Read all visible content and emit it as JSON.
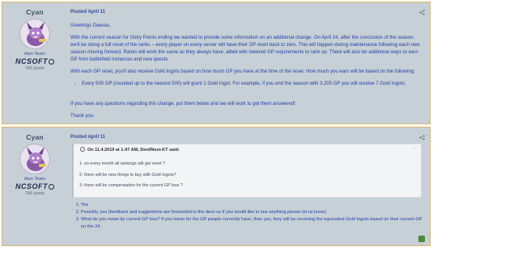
{
  "post1": {
    "author": {
      "name": "Cyan",
      "role": "Aion Team",
      "company": "NCSOFT",
      "post_count": "766 posts"
    },
    "date": "Posted April 11",
    "paragraphs": [
      "Greetings Daevas,",
      "With the current season for Glory Points ending we wanted to provide some information on an additional change. On April 24,  after the conclusion of the season, we'll be doing a full reset of the ranks – every player on every server will have their GP reset back to zero. This will happen during maintenance following each new season moving forward. Ranks will work the same as they always have, albeit with lowered GP requirements to rank up. There will also be additional ways to earn GP from battlefield instances and new quests.",
      "With each GP reset, you'll also receive Gold Ingots based on how much GP you have at the time of the reset.  How much you earn will be based on the following:"
    ],
    "bullets": [
      "Every 500 GP (rounded up to the nearest 500) will grant 1 Gold Ingot. For example, if you end the season with 3,205 GP you will receive 7 Gold Ingots."
    ],
    "closing": [
      "If you have any questions regarding this change, put them below and we will work to get them answered!",
      "Thank you."
    ]
  },
  "post2": {
    "author": {
      "name": "Cyan",
      "role": "Aion Team",
      "company": "NCSOFT",
      "post_count": "766 posts"
    },
    "date": "Posted April 11",
    "quote": {
      "header": "On 11.4.2019 at 1:47 AM, DevilNest-KT said:",
      "lines": [
        "1- so every month all rankings will get reset ?",
        "2- there will be new things to buy with Gold Ingots?",
        "3- there will be compensation for the current GP loss ?"
      ]
    },
    "answers": [
      "Yes",
      "Possibly, yes (feedback and suggestions are forwarded to the devs so if you would like to see anything please let us know)",
      "What do you mean by current GP loss? If you mean for the GP people currently have, then yes, they will be receiving the equivalent Gold Ingots based on their current GP on the 24."
    ]
  },
  "icons": {
    "share": "share-icon",
    "quote": "quote-icon",
    "reaction": "like-icon"
  },
  "colors": {
    "post_bg": "#c7d0d6",
    "post_border": "#d9b56a",
    "link_blue": "#1f3ea8",
    "reaction_green": "#4f8a3b"
  }
}
